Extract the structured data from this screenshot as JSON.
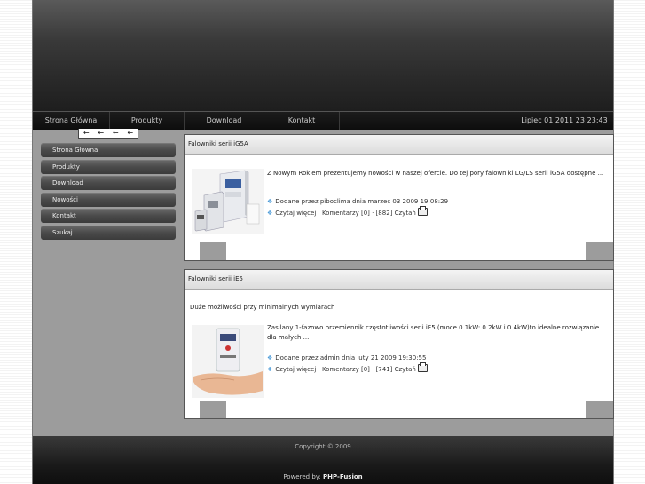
{
  "nav": {
    "items": [
      "Strona Główna",
      "Produkty",
      "Download",
      "Kontakt"
    ],
    "date": "Lipiec 01 2011 23:23:43"
  },
  "arrows": [
    "←",
    "←",
    "←",
    "←"
  ],
  "sidebar": {
    "items": [
      {
        "label": "Strona Główna"
      },
      {
        "label": "Produkty"
      },
      {
        "label": "Download"
      },
      {
        "label": "Nowości"
      },
      {
        "label": "Kontakt"
      },
      {
        "label": "Szukaj"
      }
    ]
  },
  "news": [
    {
      "title": "Falowniki serii iG5A",
      "lead": "",
      "body": "Z Nowym Rokiem prezentujemy nowości w naszej ofercie. Do tej pory falowniki LG/LS serii iG5A dostępne ...",
      "posted": "Dodane przez piboclima dnia marzec 03 2009 19:08:29",
      "links": "Czytaj więcej · Komentarzy [0] · [882] Czytań"
    },
    {
      "title": "Falowniki serii iE5",
      "lead": "Duże możliwości przy minimalnych wymiarach",
      "body": "Zasilany 1-fazowo przemiennik częstotliwości serii iE5 (moce 0.1kW: 0.2kW i 0.4kW)to idealne rozwiązanie dla małych ...",
      "posted": "Dodane przez admin dnia luty 21 2009 19:30:55",
      "links": "Czytaj więcej · Komentarzy [0] · [741] Czytań"
    }
  ],
  "footer": {
    "copyright": "Copyright © 2009",
    "powered_prefix": "Powered by: ",
    "powered_name": "PHP-Fusion"
  }
}
